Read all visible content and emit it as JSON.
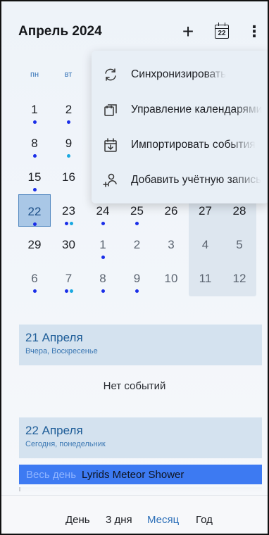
{
  "header": {
    "title": "Апрель 2024",
    "add_icon": "plus-icon",
    "today_icon_day": "22",
    "more_icon": "more-vert-icon"
  },
  "weekdays": [
    "пн",
    "вт"
  ],
  "calendar": {
    "rows": [
      [
        {
          "d": "1",
          "dots": [
            "blue"
          ]
        },
        {
          "d": "2",
          "dots": [
            "blue"
          ]
        }
      ],
      [
        {
          "d": "8",
          "dots": [
            "blue"
          ]
        },
        {
          "d": "9",
          "dots": [
            "cyan"
          ]
        }
      ],
      [
        {
          "d": "15",
          "dots": [
            "blue"
          ]
        },
        {
          "d": "16",
          "dots": []
        }
      ],
      [
        {
          "d": "22",
          "dots": [
            "blue"
          ],
          "today": true
        },
        {
          "d": "23",
          "dots": [
            "blue",
            "cyan"
          ]
        },
        {
          "d": "24",
          "dots": [
            "blue"
          ]
        },
        {
          "d": "25",
          "dots": [
            "blue"
          ]
        },
        {
          "d": "26",
          "dots": []
        },
        {
          "d": "27",
          "dots": []
        },
        {
          "d": "28",
          "dots": []
        }
      ],
      [
        {
          "d": "29",
          "dots": []
        },
        {
          "d": "30",
          "dots": []
        },
        {
          "d": "1",
          "dots": [
            "blue"
          ],
          "other": true
        },
        {
          "d": "2",
          "dots": [],
          "other": true
        },
        {
          "d": "3",
          "dots": [],
          "other": true
        },
        {
          "d": "4",
          "dots": [],
          "other": true
        },
        {
          "d": "5",
          "dots": [],
          "other": true
        }
      ],
      [
        {
          "d": "6",
          "dots": [
            "blue"
          ],
          "other": true
        },
        {
          "d": "7",
          "dots": [
            "blue",
            "cyan"
          ],
          "other": true
        },
        {
          "d": "8",
          "dots": [
            "blue"
          ],
          "other": true
        },
        {
          "d": "9",
          "dots": [
            "blue"
          ],
          "other": true
        },
        {
          "d": "10",
          "dots": [],
          "other": true
        },
        {
          "d": "11",
          "dots": [],
          "other": true
        },
        {
          "d": "12",
          "dots": [],
          "other": true
        }
      ]
    ]
  },
  "menu": {
    "items": [
      {
        "label": "Синхронизировать",
        "icon": "sync-icon"
      },
      {
        "label": "Управление календарями",
        "icon": "manage-calendars-icon"
      },
      {
        "label": "Импортировать события",
        "icon": "import-events-icon"
      },
      {
        "label": "Добавить учётную запись",
        "icon": "add-account-icon"
      }
    ]
  },
  "agenda": {
    "days": [
      {
        "title": "21 Апреля",
        "subtitle": "Вчера, Воскресенье"
      },
      {
        "title": "22 Апреля",
        "subtitle": "Сегодня, понедельник"
      }
    ],
    "no_events": "Нет событий",
    "event": {
      "time": "Весь день",
      "title": "Lyrids Meteor Shower"
    }
  },
  "bottom_tabs": [
    {
      "label": "День",
      "active": false
    },
    {
      "label": "3 дня",
      "active": false
    },
    {
      "label": "Месяц",
      "active": true
    },
    {
      "label": "Год",
      "active": false
    }
  ],
  "colors": {
    "accent": "#2c6fb8",
    "today_bg": "#a9c7e6",
    "dot_blue": "#1a2ee8",
    "dot_cyan": "#19a8e0",
    "event_bg": "#3d7af2"
  }
}
